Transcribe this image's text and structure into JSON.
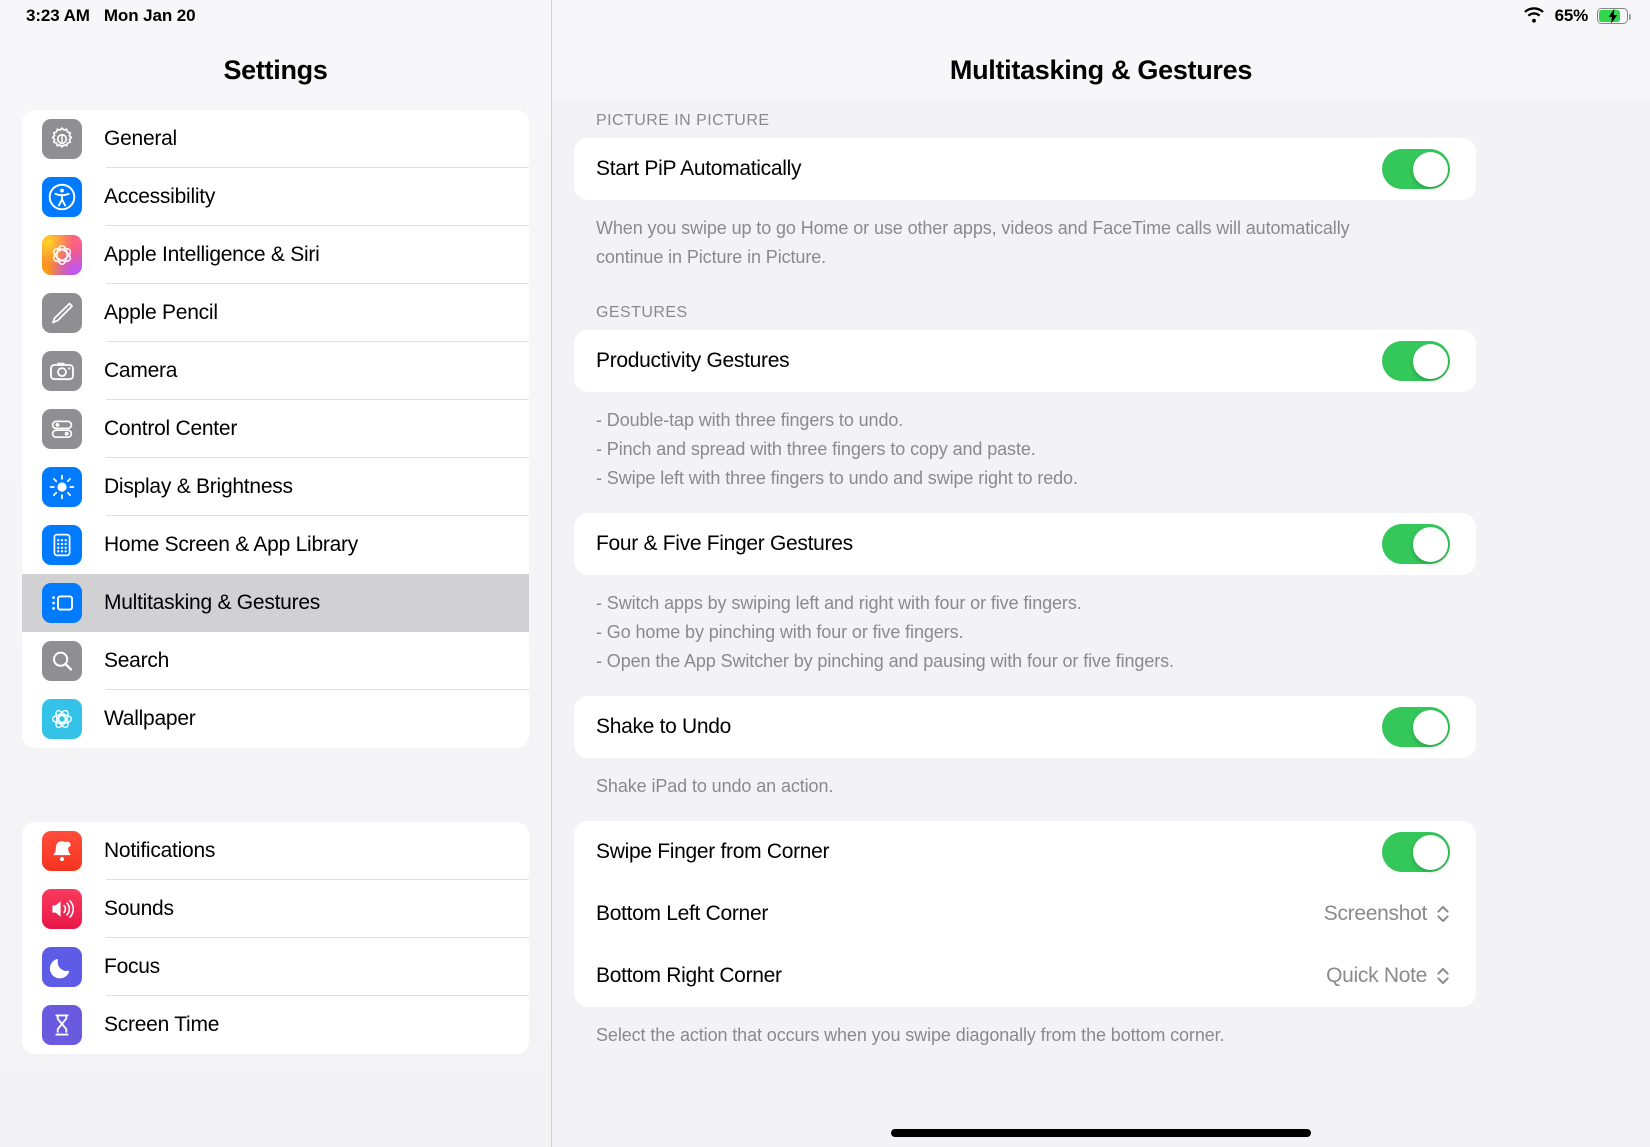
{
  "status_bar": {
    "time": "3:23 AM",
    "date": "Mon Jan 20",
    "battery_percent": "65%",
    "wifi_icon": "wifi-icon",
    "battery_icon": "battery-charging-icon",
    "battery_level": 65,
    "charging": true
  },
  "sidebar": {
    "title": "Settings",
    "groups": [
      {
        "items": [
          {
            "label": "General",
            "icon": "gear-icon",
            "icon_style": "ic-gray",
            "selected": false
          },
          {
            "label": "Accessibility",
            "icon": "accessibility-icon",
            "icon_style": "ic-blue",
            "selected": false
          },
          {
            "label": "Apple Intelligence & Siri",
            "icon": "siri-icon",
            "icon_style": "ic-siri",
            "selected": false
          },
          {
            "label": "Apple Pencil",
            "icon": "pencil-icon",
            "icon_style": "ic-gray",
            "selected": false
          },
          {
            "label": "Camera",
            "icon": "camera-icon",
            "icon_style": "ic-gray",
            "selected": false
          },
          {
            "label": "Control Center",
            "icon": "control-center-icon",
            "icon_style": "ic-gray",
            "selected": false
          },
          {
            "label": "Display & Brightness",
            "icon": "brightness-icon",
            "icon_style": "ic-blue",
            "selected": false
          },
          {
            "label": "Home Screen & App Library",
            "icon": "app-grid-icon",
            "icon_style": "ic-blue",
            "selected": false
          },
          {
            "label": "Multitasking & Gestures",
            "icon": "multitasking-icon",
            "icon_style": "ic-blue",
            "selected": true
          },
          {
            "label": "Search",
            "icon": "search-icon",
            "icon_style": "ic-gray",
            "selected": false
          },
          {
            "label": "Wallpaper",
            "icon": "wallpaper-icon",
            "icon_style": "ic-teal",
            "selected": false
          }
        ]
      },
      {
        "items": [
          {
            "label": "Notifications",
            "icon": "bell-icon",
            "icon_style": "ic-red",
            "selected": false
          },
          {
            "label": "Sounds",
            "icon": "speaker-icon",
            "icon_style": "ic-pink",
            "selected": false
          },
          {
            "label": "Focus",
            "icon": "moon-icon",
            "icon_style": "ic-indigo",
            "selected": false
          },
          {
            "label": "Screen Time",
            "icon": "hourglass-icon",
            "icon_style": "ic-purple",
            "selected": false
          }
        ]
      }
    ]
  },
  "detail": {
    "title": "Multitasking & Gestures",
    "sections": {
      "pip": {
        "header": "PICTURE IN PICTURE",
        "start_pip_label": "Start PiP Automatically",
        "start_pip_enabled": true,
        "footnote_line1": "When you swipe up to go Home or use other apps, videos and FaceTime calls will automatically",
        "footnote_line2": "continue in Picture in Picture."
      },
      "gestures": {
        "header": "GESTURES",
        "productivity_label": "Productivity Gestures",
        "productivity_enabled": true,
        "productivity_notes": [
          "- Double-tap with three fingers to undo.",
          "- Pinch and spread with three fingers to copy and paste.",
          "- Swipe left with three fingers to undo and swipe right to redo."
        ],
        "four_five_label": "Four & Five Finger Gestures",
        "four_five_enabled": true,
        "four_five_notes": [
          "- Switch apps by swiping left and right with four or five fingers.",
          "- Go home by pinching with four or five fingers.",
          "- Open the App Switcher by pinching and pausing with four or five fingers."
        ],
        "shake_label": "Shake to Undo",
        "shake_enabled": true,
        "shake_note": "Shake iPad to undo an action."
      },
      "corner": {
        "swipe_corner_label": "Swipe Finger from Corner",
        "swipe_corner_enabled": true,
        "bottom_left_label": "Bottom Left Corner",
        "bottom_left_value": "Screenshot",
        "bottom_right_label": "Bottom Right Corner",
        "bottom_right_value": "Quick Note",
        "footnote": "Select the action that occurs when you swipe diagonally from the bottom corner."
      }
    }
  },
  "colors": {
    "toggle_on": "#34C759",
    "accent_blue": "#007AFF",
    "selected_row": "#D1D1D4",
    "secondary_text": "#8A8A8E",
    "page_bg": "#F2F2F7"
  }
}
